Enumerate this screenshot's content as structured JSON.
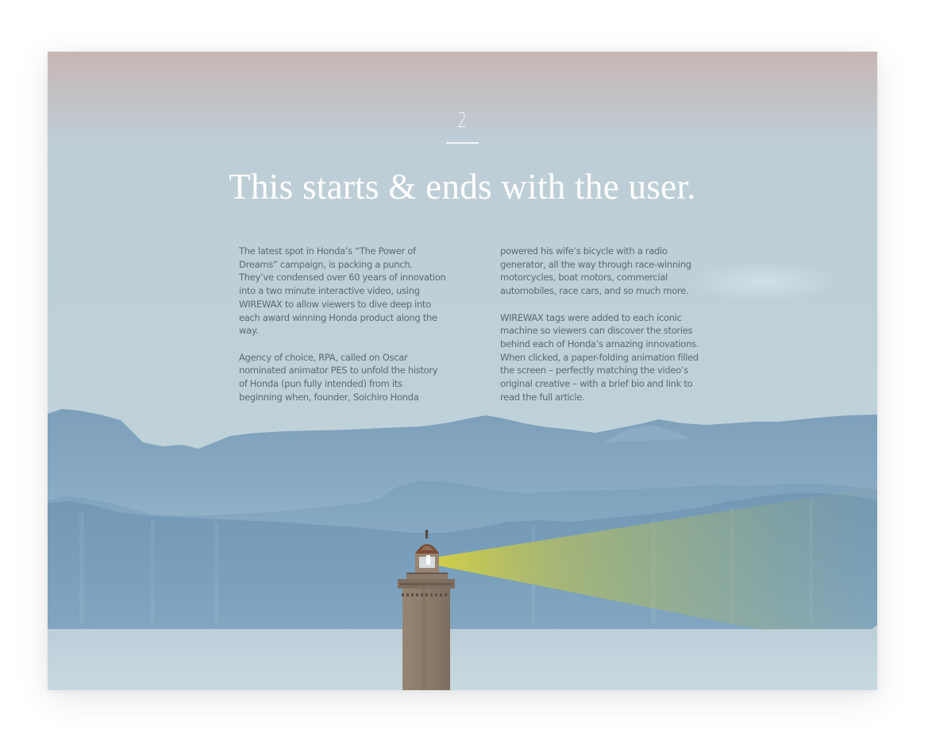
{
  "section": {
    "number": "2",
    "headline": "This starts & ends with the user."
  },
  "body": {
    "left": {
      "p1": "The latest spot in Honda’s “The Power of Dreams” campaign, is packing a punch. They’ve condensed over 60 years of innovation into a two minute interactive video, using WIREWAX to allow viewers to dive deep into each award winning Honda product along the way.",
      "p2": "Agency of choice, RPA, called on Oscar nominated animator PES to unfold the history of Honda (pun fully intended) from its beginning when, founder, Soichiro Honda"
    },
    "right": {
      "p1": "powered his wife’s bicycle with a radio generator, all the way through race-winning motorcycles, boat motors, commercial automobiles, race cars, and so much more.",
      "p2": "WIREWAX tags were added to each iconic machine so viewers can discover the stories behind each of Honda’s amazing innovations. When clicked, a paper-folding animation filled the screen – perfectly matching the video’s original creative – with a brief bio and link to read the full article."
    }
  },
  "colors": {
    "sky_top": "#c8b5b4",
    "sky": "#bdd0d8",
    "far_mountains": "#7b9fbb",
    "near_mountains": "#6f93b3",
    "water": "#c4d5dd",
    "lighthouse": "#8a7868",
    "beam": "#c9c34a"
  }
}
